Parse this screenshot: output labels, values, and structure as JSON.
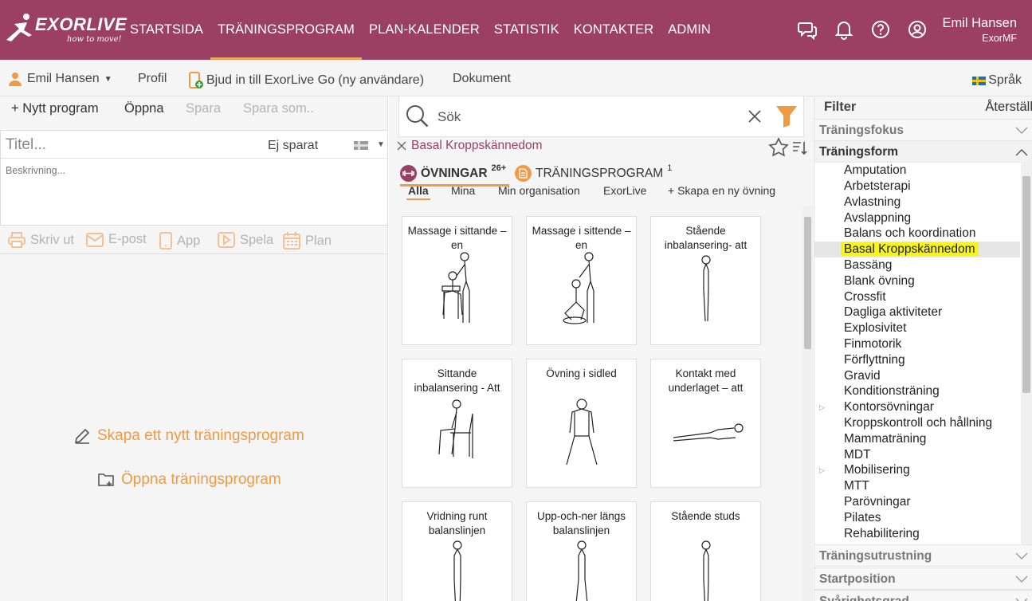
{
  "brand": {
    "name": "EXORLIVE",
    "tagline": "how to move!"
  },
  "nav": {
    "items": [
      "STARTSIDA",
      "TRÄNINGSPROGRAM",
      "PLAN-KALENDER",
      "STATISTIK",
      "KONTAKTER",
      "ADMIN"
    ],
    "active": "TRÄNINGSPROGRAM"
  },
  "user": {
    "name": "Emil Hansen",
    "org": "ExorMF"
  },
  "subbar": {
    "user_menu": "Emil Hansen",
    "profile": "Profil",
    "invite": "Bjud in till ExorLive Go (ny användare)",
    "documents": "Dokument",
    "language": "Språk"
  },
  "toolbar": {
    "new": "+ Nytt program",
    "open": "Öppna",
    "save": "Spara",
    "save_as": "Spara som.."
  },
  "editor": {
    "title_placeholder": "Titel...",
    "status": "Ej sparat",
    "desc_placeholder": "Beskrivning..."
  },
  "actions": {
    "print": "Skriv ut",
    "email": "E-post",
    "app": "App",
    "play": "Spela",
    "plan": "Plan"
  },
  "empty": {
    "create": "Skapa ett nytt träningsprogram",
    "open": "Öppna träningsprogram"
  },
  "search": {
    "placeholder": "Sök",
    "active_filter": "Basal Kroppskännedom"
  },
  "tabs": {
    "exercises": {
      "label": "ÖVNINGAR",
      "count": "26+"
    },
    "programs": {
      "label": "TRÄNINGSPROGRAM",
      "count": "1"
    }
  },
  "subtabs": [
    "Alla",
    "Mina",
    "Min organisation",
    "ExorLive",
    "+ Skapa en ny övning"
  ],
  "exercises": [
    {
      "title": "Massage i sittande –en"
    },
    {
      "title": "Massage i sittende – en"
    },
    {
      "title": "Stående inbalansering- att"
    },
    {
      "title": "Sittande inbalansering - Att"
    },
    {
      "title": "Övning i sidled"
    },
    {
      "title": "Kontakt med underlaget – att"
    },
    {
      "title": "Vridning runt balanslinjen"
    },
    {
      "title": "Upp-och-ner längs balanslinjen"
    },
    {
      "title": "Stående studs"
    }
  ],
  "filter": {
    "title": "Filter",
    "reset": "Återställ",
    "sections": {
      "focus": "Träningsfokus",
      "form": "Träningsform",
      "equipment": "Träningsutrustning",
      "start": "Startposition",
      "difficulty": "Svårighetsgrad"
    },
    "form_items": [
      "Amputation",
      "Arbetsterapi",
      "Avlastning",
      "Avslappning",
      "Balans och koordination",
      "Basal Kroppskännedom",
      "Bassäng",
      "Blank övning",
      "Crossfit",
      "Dagliga aktiviteter",
      "Explosivitet",
      "Finmotorik",
      "Förflyttning",
      "Gravid",
      "Konditionsträning",
      "Kontorsövningar",
      "Kroppskontroll och hållning",
      "Mammaträning",
      "MDT",
      "Mobilisering",
      "MTT",
      "Parövningar",
      "Pilates",
      "Rehabilitering"
    ],
    "selected": "Basal Kroppskännedom"
  },
  "colors": {
    "brand": "#9b3f63",
    "accent": "#ef9a44",
    "highlight": "#f7f321"
  }
}
